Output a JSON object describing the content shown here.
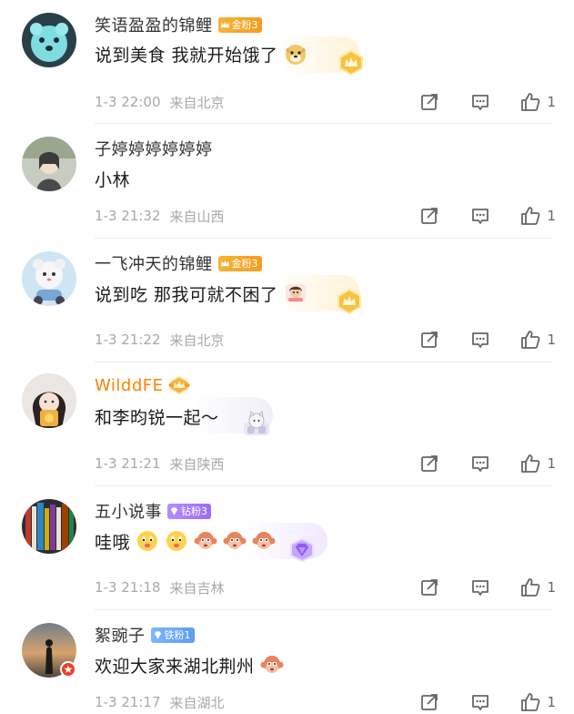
{
  "comments": [
    {
      "name": "笑语盈盈的锦鲤",
      "badge": {
        "label": "金粉3",
        "kind": "gold"
      },
      "text": "说到美食 我就开始饿了",
      "emojis": [
        "doge-emoji"
      ],
      "time": "1-3 22:00",
      "location": "来自北京",
      "likes": "1"
    },
    {
      "name": "子婷婷婷婷婷婷",
      "badge": null,
      "text": "小林",
      "emojis": [],
      "time": "1-3 21:32",
      "location": "来自山西",
      "likes": "1"
    },
    {
      "name": "一飞冲天的锦鲤",
      "badge": {
        "label": "金粉3",
        "kind": "gold"
      },
      "text": "说到吃 那我可就不困了",
      "emojis": [
        "sticker-emoji"
      ],
      "time": "1-3 21:22",
      "location": "来自北京",
      "likes": "1"
    },
    {
      "name": "WilddFE",
      "badge": null,
      "text": "和李昀锐一起～",
      "emojis": [],
      "time": "1-3 21:21",
      "location": "来自陕西",
      "likes": "1"
    },
    {
      "name": "五小说事",
      "badge": {
        "label": "钻粉3",
        "kind": "diamond"
      },
      "text": "哇哦",
      "emojis": [
        "drool-emoji",
        "drool-emoji",
        "monkey-emoji",
        "monkey-emoji",
        "monkey-emoji"
      ],
      "time": "1-3 21:18",
      "location": "来自吉林",
      "likes": "1"
    },
    {
      "name": "絮豌子",
      "badge": {
        "label": "铁粉1",
        "kind": "iron"
      },
      "text": "欢迎大家来湖北荆州",
      "emojis": [
        "monkey-emoji"
      ],
      "time": "1-3 21:17",
      "location": "来自湖北",
      "likes": "1"
    }
  ],
  "colors": {
    "name": "#333333",
    "name_highlight": "#ff8200",
    "meta": "#a8a8a8",
    "divider": "#ececec",
    "gold_badge": "#f6b336",
    "diamond_badge": "#9b6cf5",
    "iron_badge": "#5c9cf2"
  }
}
